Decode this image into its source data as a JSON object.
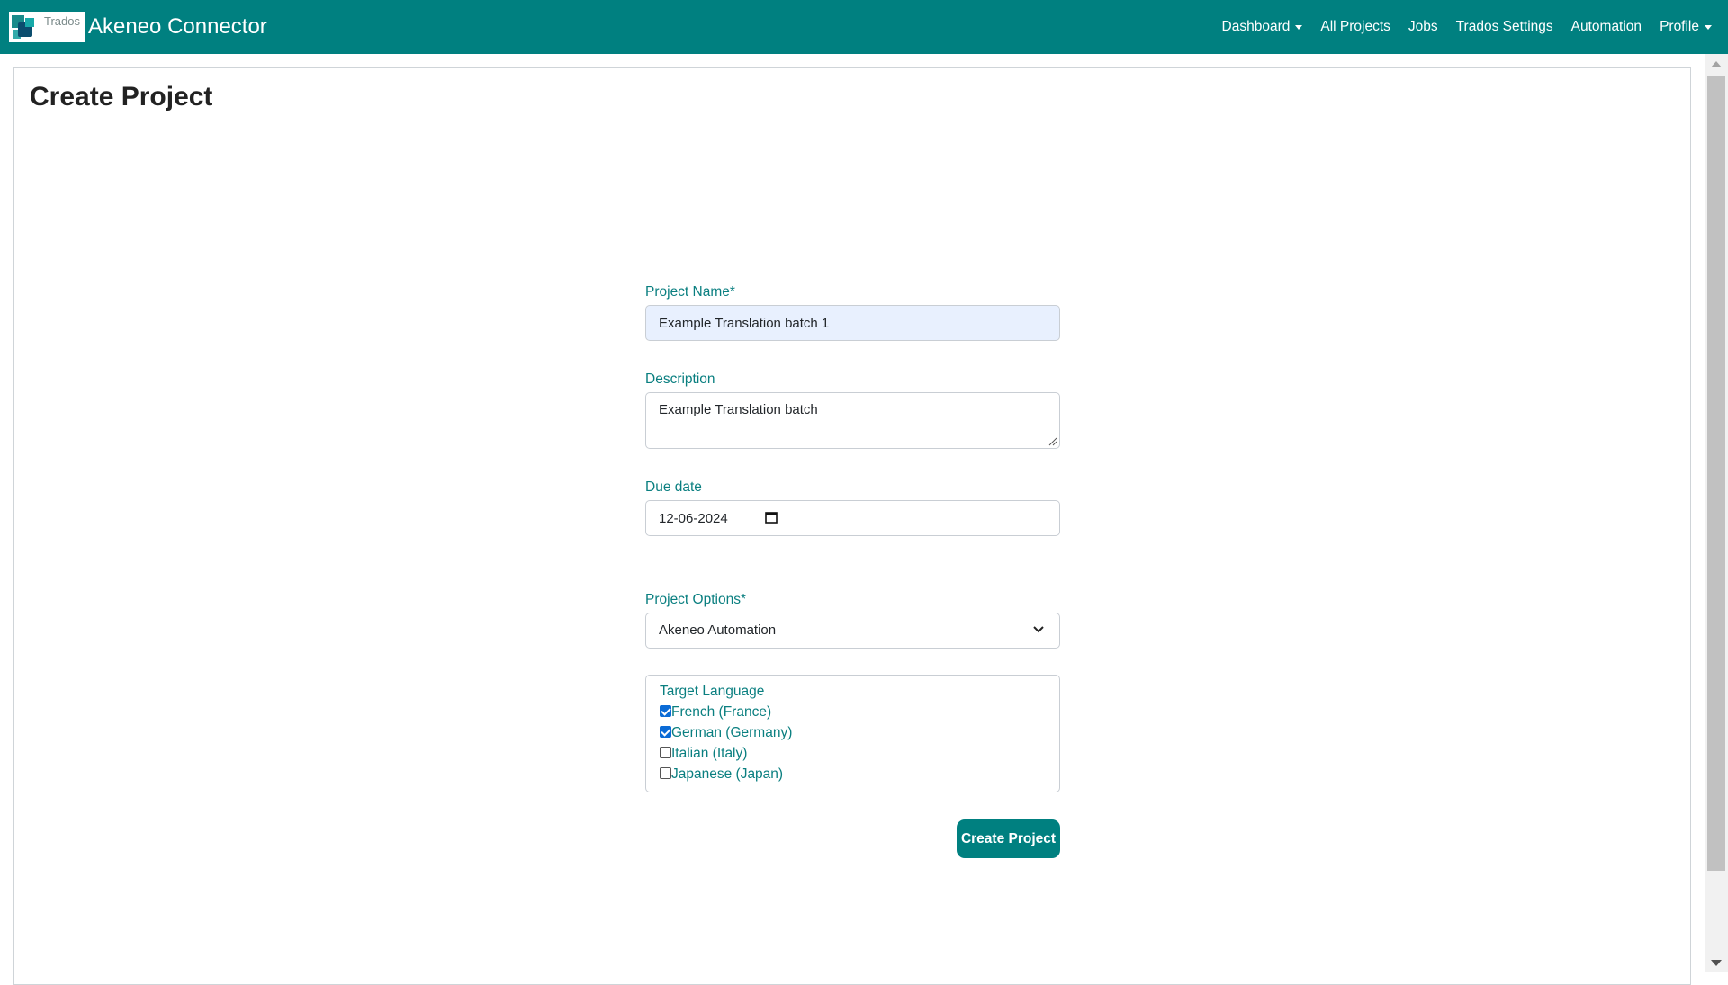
{
  "navbar": {
    "logo_text": "Trados",
    "brand_title": "Akeneo Connector",
    "links": [
      {
        "label": "Dashboard",
        "has_dropdown": true
      },
      {
        "label": "All Projects",
        "has_dropdown": false
      },
      {
        "label": "Jobs",
        "has_dropdown": false
      },
      {
        "label": "Trados Settings",
        "has_dropdown": false
      },
      {
        "label": "Automation",
        "has_dropdown": false
      },
      {
        "label": "Profile",
        "has_dropdown": true
      }
    ]
  },
  "page": {
    "title": "Create Project"
  },
  "form": {
    "project_name": {
      "label": "Project Name*",
      "value": "Example Translation batch 1"
    },
    "description": {
      "label": "Description",
      "value": "Example Translation batch"
    },
    "due_date": {
      "label": "Due date",
      "value": "12-06-2024"
    },
    "project_options": {
      "label": "Project Options*",
      "selected": "Akeneo Automation"
    },
    "target_language": {
      "title": "Target Language",
      "options": [
        {
          "label": "French (France)",
          "checked": true
        },
        {
          "label": "German (Germany)",
          "checked": true
        },
        {
          "label": "Italian (Italy)",
          "checked": false
        },
        {
          "label": "Japanese (Japan)",
          "checked": false
        }
      ]
    },
    "submit_label": "Create Project"
  },
  "colors": {
    "brand": "#008080",
    "label": "#0a7f80",
    "autofill_bg": "#e8f0fe"
  }
}
